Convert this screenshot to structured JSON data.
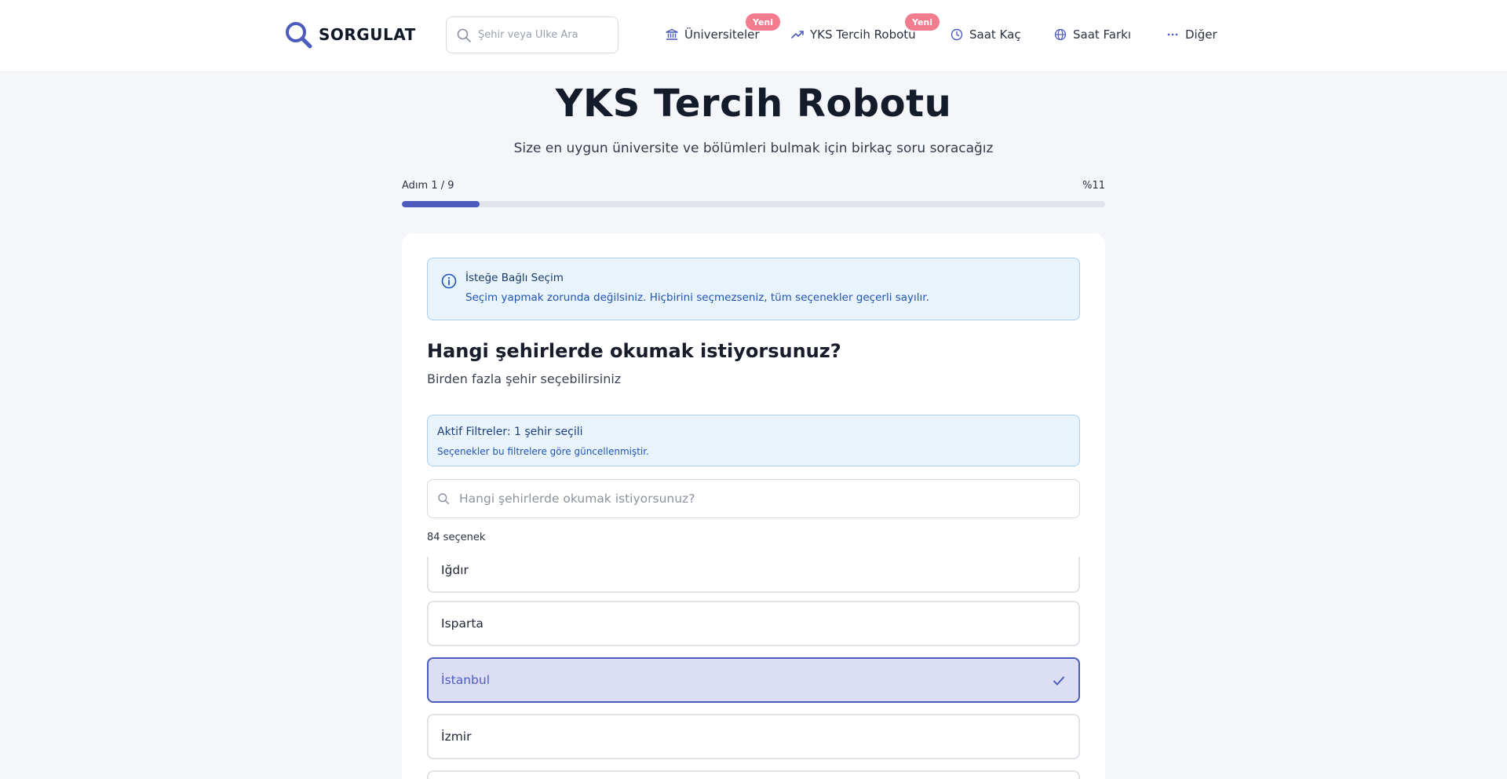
{
  "header": {
    "logo_text": "SORGULAT",
    "search_placeholder": "Şehir veya Ülke Ara",
    "nav": [
      {
        "label": "Üniversiteler",
        "badge": "Yeni"
      },
      {
        "label": "YKS Tercih Robotu",
        "badge": "Yeni"
      },
      {
        "label": "Saat Kaç"
      },
      {
        "label": "Saat Farkı"
      },
      {
        "label": "Diğer"
      }
    ]
  },
  "hero": {
    "title": "YKS Tercih Robotu",
    "subtitle": "Size en uygun üniversite ve bölümleri bulmak için birkaç soru soracağız"
  },
  "progress": {
    "step_label": "Adım 1 / 9",
    "percent_label": "%11",
    "fraction": 0.111
  },
  "card": {
    "info_title": "İsteğe Bağlı Seçim",
    "info_text": "Seçim yapmak zorunda değilsiniz. Hiçbirini seçmezseniz, tüm seçenekler geçerli sayılır.",
    "question": "Hangi şehirlerde okumak istiyorsunuz?",
    "question_sub": "Birden fazla şehir seçebilirsiniz",
    "filter_title": "Aktif Filtreler: 1 şehir seçili",
    "filter_text": "Seçenekler bu filtrelere göre güncellenmiştir.",
    "list_search_placeholder": "Hangi şehirlerde okumak istiyorsunuz?",
    "count_label": "84 seçenek",
    "options": [
      {
        "label": "Iğdır",
        "selected": false
      },
      {
        "label": "Isparta",
        "selected": false
      },
      {
        "label": "İstanbul",
        "selected": true
      },
      {
        "label": "İzmir",
        "selected": false
      }
    ]
  },
  "colors": {
    "accent": "#4d5bbd",
    "badge": "#f27c8e",
    "info_bg": "#e9f3fc",
    "info_border": "#a9d1f1"
  },
  "icons": {
    "logo": "search-magnifier-icon",
    "nav_universities": "bank-building-icon",
    "nav_tercih": "trending-up-icon",
    "nav_saat": "clock-icon",
    "nav_fark": "globe-icon",
    "nav_diger": "ellipsis-icon",
    "info": "info-circle-icon",
    "selected": "check-icon"
  }
}
